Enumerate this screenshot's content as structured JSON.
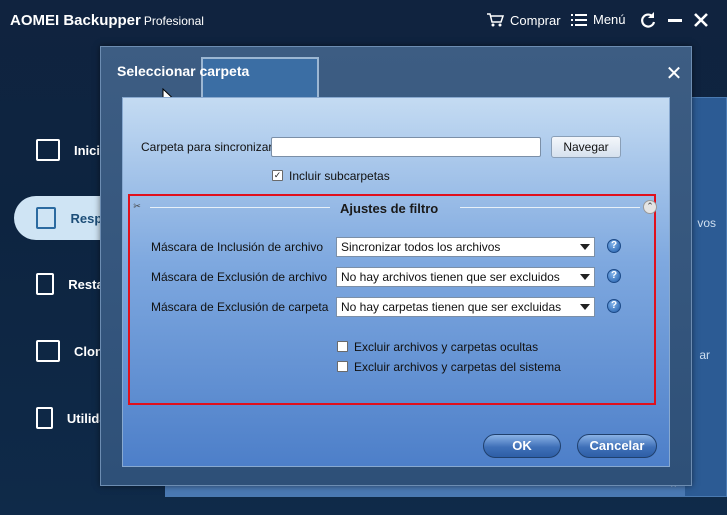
{
  "app": {
    "title": "AOMEI Backupper",
    "edition": "Profesional"
  },
  "titlebar": {
    "buy_label": "Comprar",
    "menu_label": "Menú"
  },
  "sidebar": {
    "items": [
      {
        "label": "Inicio",
        "icon": "home-monitor-icon"
      },
      {
        "label": "Respaldo",
        "icon": "backup-icon"
      },
      {
        "label": "Restaurar",
        "icon": "restore-icon"
      },
      {
        "label": "Clonar",
        "icon": "clone-icon"
      },
      {
        "label": "Utilidades",
        "icon": "tools-icon"
      }
    ]
  },
  "outer_dialog": {
    "title": "Seleccionar carpeta"
  },
  "dialog": {
    "folder_label": "Carpeta para sincronizar",
    "folder_value": "",
    "browse_label": "Navegar",
    "include_subfolders": {
      "label": "Incluir subcarpetas",
      "checked": true
    },
    "filter_title": "Ajustes de filtro",
    "rows": [
      {
        "label": "Máscara de Inclusión de archivo",
        "value": "Sincronizar todos los archivos"
      },
      {
        "label": "Máscara de Exclusión de archivo",
        "value": "No hay archivos tienen que ser excluidos"
      },
      {
        "label": "Máscara de Exclusión de carpeta",
        "value": "No hay carpetas tienen que ser excluidas"
      }
    ],
    "exclude_hidden": {
      "label": "Excluir archivos y carpetas ocultas",
      "checked": false
    },
    "exclude_system": {
      "label": "Excluir archivos y carpetas del sistema",
      "checked": false
    },
    "ok_label": "OK",
    "cancel_label": "Cancelar"
  },
  "background": {
    "partial_right_1": "vos",
    "partial_right_2": "ar"
  },
  "colors": {
    "highlight_border": "#e0101c",
    "accent": "#2d5ea6"
  }
}
